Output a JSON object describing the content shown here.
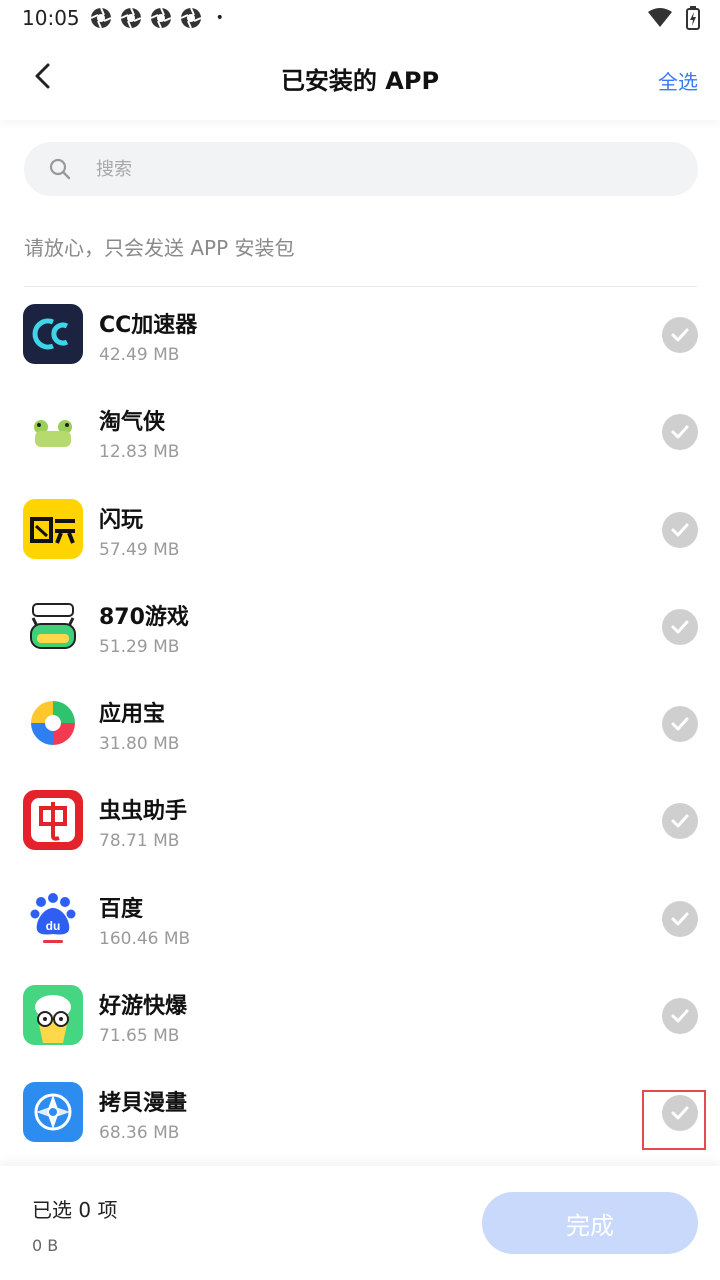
{
  "status_bar": {
    "time": "10:05",
    "notification_icons": [
      "aperture-icon",
      "aperture-icon",
      "aperture-icon",
      "aperture-icon"
    ],
    "dot": "•"
  },
  "header": {
    "title": "已安装的 APP",
    "select_all": "全选",
    "accent_color": "#3a7bf2"
  },
  "search": {
    "placeholder": "搜索"
  },
  "notice": "请放心，只会发送 APP 安装包",
  "apps": [
    {
      "name": "CC加速器",
      "size": "42.49 MB",
      "icon": "cc-accelerator-icon"
    },
    {
      "name": "淘气侠",
      "size": "12.83 MB",
      "icon": "taoqixia-icon"
    },
    {
      "name": "闪玩",
      "size": "57.49 MB",
      "icon": "shanwan-icon"
    },
    {
      "name": "870游戏",
      "size": "51.29 MB",
      "icon": "870-games-icon"
    },
    {
      "name": "应用宝",
      "size": "31.80 MB",
      "icon": "yingyongbao-icon"
    },
    {
      "name": "虫虫助手",
      "size": "78.71 MB",
      "icon": "chongchong-icon"
    },
    {
      "name": "百度",
      "size": "160.46 MB",
      "icon": "baidu-icon"
    },
    {
      "name": "好游快爆",
      "size": "71.65 MB",
      "icon": "haoyou-icon"
    },
    {
      "name": "拷貝漫畫",
      "size": "68.36 MB",
      "icon": "copy-manga-icon"
    }
  ],
  "footer": {
    "selected_count": "已选 0 项",
    "selected_size": "0 B",
    "done_label": "完成"
  }
}
